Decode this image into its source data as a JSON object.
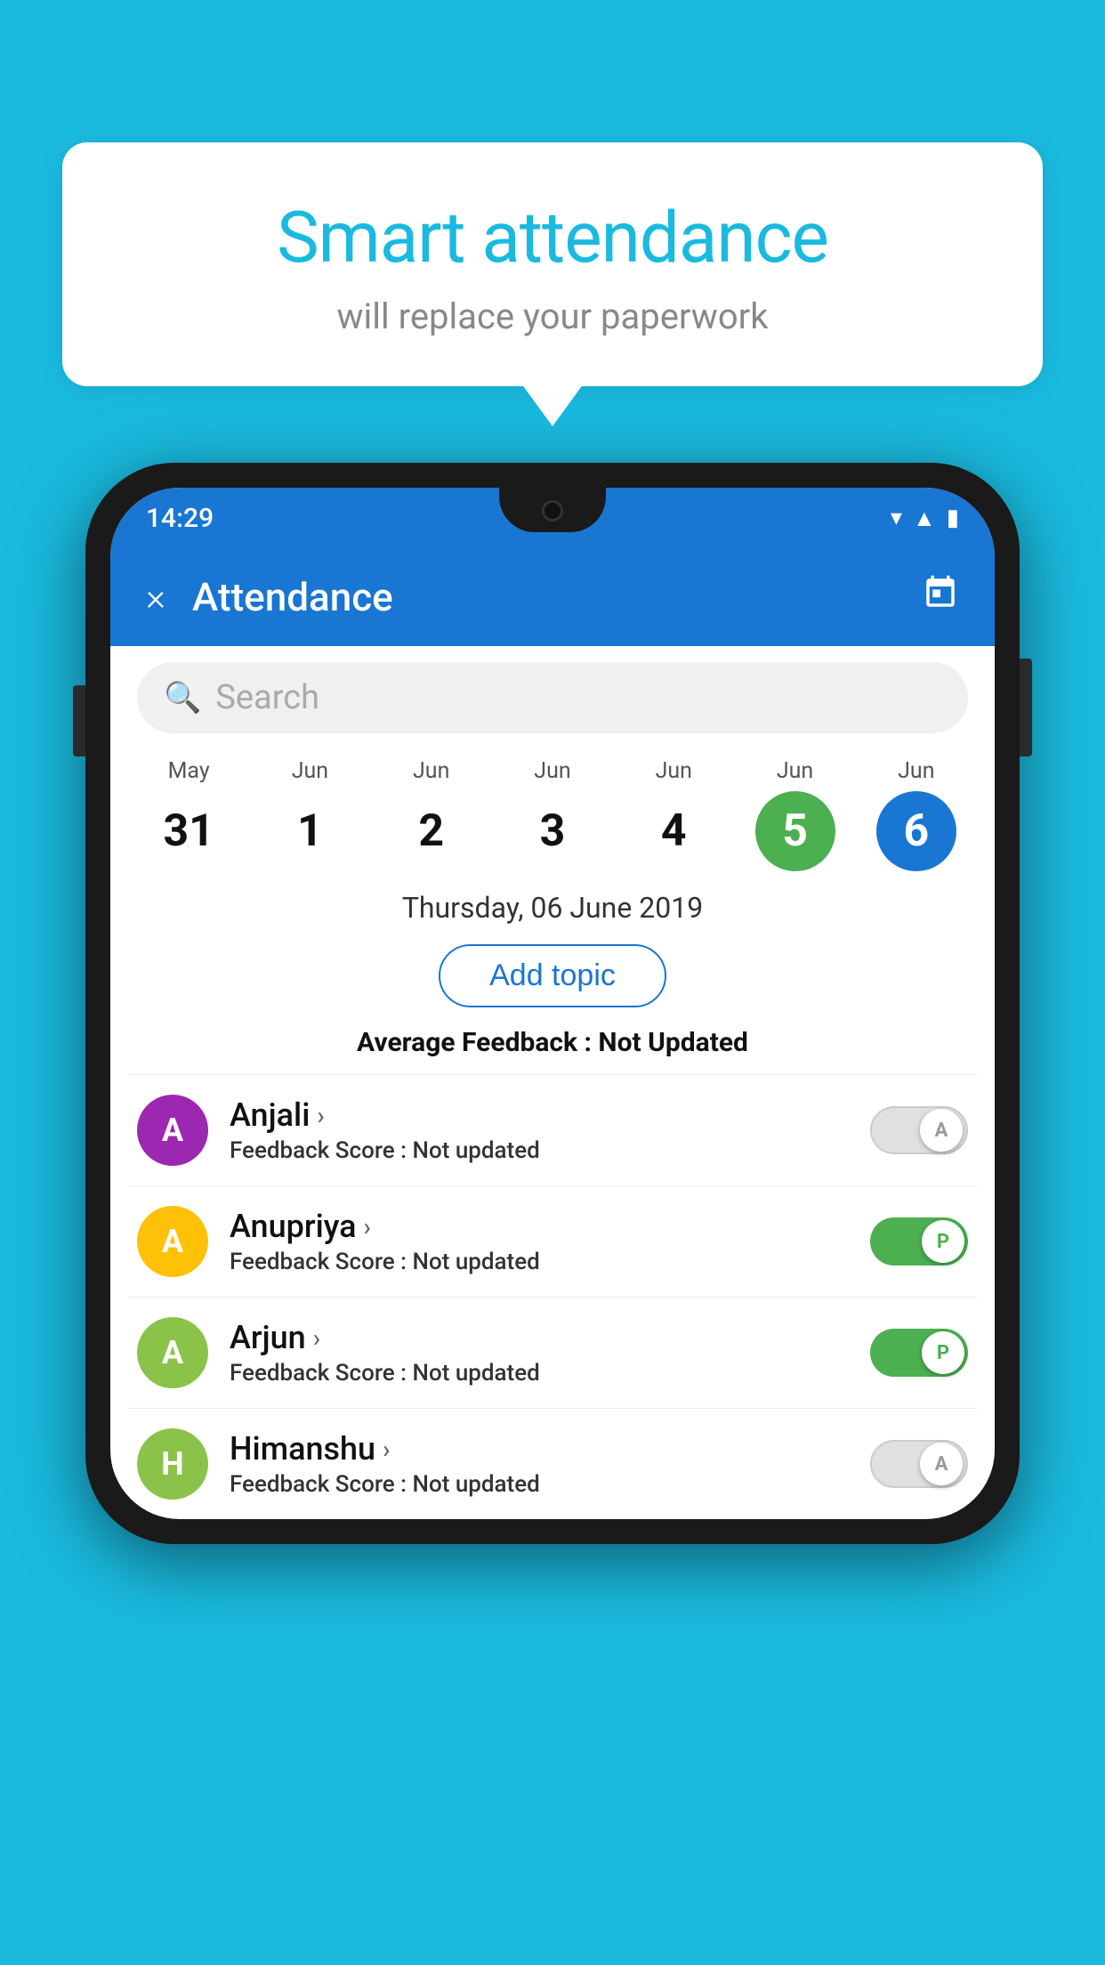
{
  "background_color": "#1ABADF",
  "bubble": {
    "title": "Smart attendance",
    "subtitle": "will replace your paperwork"
  },
  "status_bar": {
    "time": "14:29",
    "icons": [
      "wifi",
      "signal",
      "battery"
    ]
  },
  "app_bar": {
    "title": "Attendance",
    "close_label": "×"
  },
  "search": {
    "placeholder": "Search"
  },
  "calendar": {
    "days": [
      {
        "month": "May",
        "date": "31",
        "style": "normal"
      },
      {
        "month": "Jun",
        "date": "1",
        "style": "normal"
      },
      {
        "month": "Jun",
        "date": "2",
        "style": "normal"
      },
      {
        "month": "Jun",
        "date": "3",
        "style": "normal"
      },
      {
        "month": "Jun",
        "date": "4",
        "style": "normal"
      },
      {
        "month": "Jun",
        "date": "5",
        "style": "today"
      },
      {
        "month": "Jun",
        "date": "6",
        "style": "selected"
      }
    ],
    "selected_date": "Thursday, 06 June 2019"
  },
  "add_topic_label": "Add topic",
  "avg_feedback_label": "Average Feedback :",
  "avg_feedback_value": "Not Updated",
  "students": [
    {
      "name": "Anjali",
      "avatar_letter": "A",
      "avatar_color": "#9C27B0",
      "feedback_label": "Feedback Score :",
      "feedback_value": "Not updated",
      "toggle": "off",
      "toggle_letter": "A"
    },
    {
      "name": "Anupriya",
      "avatar_letter": "A",
      "avatar_color": "#FFC107",
      "feedback_label": "Feedback Score :",
      "feedback_value": "Not updated",
      "toggle": "on",
      "toggle_letter": "P"
    },
    {
      "name": "Arjun",
      "avatar_letter": "A",
      "avatar_color": "#8BC34A",
      "feedback_label": "Feedback Score :",
      "feedback_value": "Not updated",
      "toggle": "on",
      "toggle_letter": "P"
    },
    {
      "name": "Himanshu",
      "avatar_letter": "H",
      "avatar_color": "#8BC34A",
      "feedback_label": "Feedback Score :",
      "feedback_value": "Not updated",
      "toggle": "off",
      "toggle_letter": "A"
    }
  ]
}
